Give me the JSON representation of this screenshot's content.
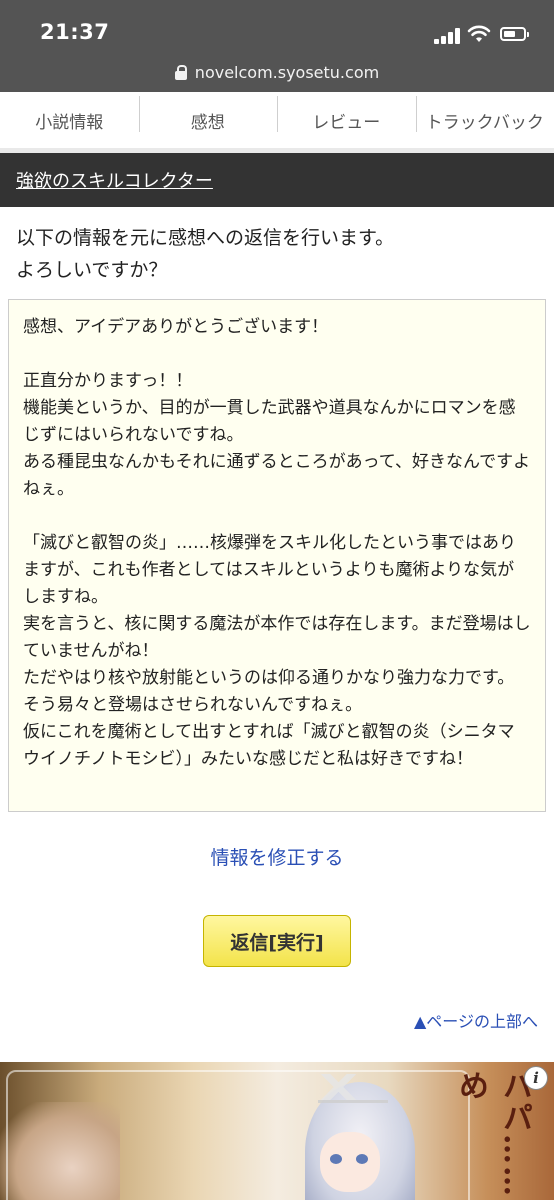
{
  "status_bar": {
    "time": "21:37",
    "icons": [
      "cellular-signal-icon",
      "wifi-icon",
      "battery-icon"
    ]
  },
  "browser": {
    "url": "novelcom.syosetu.com",
    "lock_icon": "lock-icon"
  },
  "tabs": [
    {
      "label": "小説情報"
    },
    {
      "label": "感想"
    },
    {
      "label": "レビュー"
    },
    {
      "label": "トラックバック"
    }
  ],
  "novel_title": "強欲のスキルコレクター",
  "confirm_text": "以下の情報を元に感想への返信を行います。\nよろしいですか？",
  "reply_message": "感想、アイデアありがとうございます！\n\n正直分かりますっ！！\n機能美というか、目的が一貫した武器や道具なんかにロマンを感じずにはいられないですね。\nある種昆虫なんかもそれに通ずるところがあって、好きなんですよねぇ。\n\n「滅びと叡智の炎」……核爆弾をスキル化したという事ではありますが、これも作者としてはスキルというよりも魔術よりな気がしますね。\n実を言うと、核に関する魔法が本作では存在します。まだ登場はしていませんがね！\nただやはり核や放射能というのは仰る通りかなり強力な力です。そう易々と登場はさせられないんですねぇ。\n仮にこれを魔術として出すとすれば「滅びと叡智の炎（シニタマウイノチノトモシビ）」みたいな感じだと私は好きですね！",
  "edit_link": "情報を修正する",
  "submit_button": "返信[実行]",
  "back_to_top": "▲ページの上部へ",
  "ad": {
    "vertical_text": "パパ……め",
    "info_icon": "i"
  },
  "colors": {
    "chrome_bg": "#545454",
    "title_bar_bg": "#333333",
    "message_box_bg": "#fffff0",
    "link": "#2a4fb5",
    "button_yellow": "#f3e34a"
  }
}
